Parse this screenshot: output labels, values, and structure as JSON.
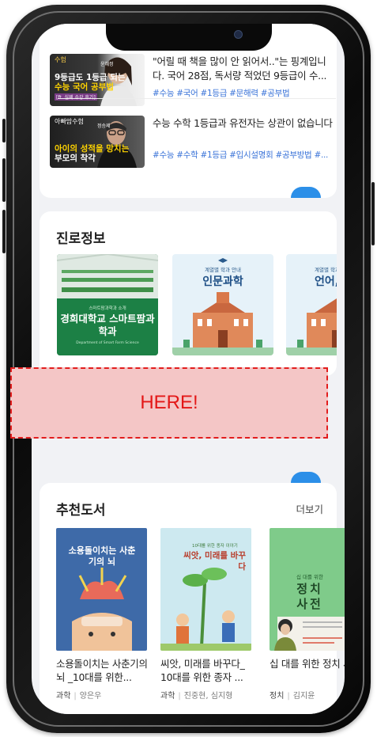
{
  "videos": [
    {
      "thumb_badge": "수험",
      "thumb_name": "윤혜정",
      "thumb_line1": "9등급도 1등급 되는",
      "thumb_line2": "수능 국어 공부법",
      "thumb_line3": "[ft. 실제 수강 후기]",
      "title": "\"어릴 때 책을 많이 안 읽어서..\"는 핑계입니다. 국어 28점, 독서량 적었던 9등급이 수...",
      "tags": "#수능 #국어 #1등급 #문해력 #공부법"
    },
    {
      "thumb_badge": "아빠맘수험",
      "thumb_name": "정승제",
      "thumb_line1": "아이의 성적을 망치는",
      "thumb_line2": "부모의 착각",
      "title": "수능 수학 1등급과 유전자는 상관이 없습니다",
      "tags": "#수능 #수학 #1등급 #입시설명회 #공부방법 #..."
    }
  ],
  "career": {
    "title": "진로정보",
    "items": [
      {
        "caption_small": "스마트팜과학과 소개",
        "caption_main": "경희대학교 스마트팜과학과",
        "caption_sub": "Department of Smart Farm Science"
      },
      {
        "caption_small": "계열별 학과 안내",
        "caption_main": "인문과학"
      },
      {
        "caption_small": "계열별 학과",
        "caption_main": "언어, 문"
      }
    ]
  },
  "placeholder": {
    "label": "HERE!"
  },
  "books": {
    "title": "추천도서",
    "more_label": "더보기",
    "items": [
      {
        "cover_title": "소용돌이치는 사춘기의 뇌",
        "title": "소용돌이치는 사춘기의 뇌 _10대를 위한...",
        "category": "과학",
        "author": "양은우"
      },
      {
        "cover_title": "씨앗, 미래를 바꾸다",
        "cover_small": "10대를 위한 종자 이야기",
        "title": "씨앗, 미래를 바꾸다_ 10대를 위한 종자 ...",
        "category": "과학",
        "author": "진중현, 심지형"
      },
      {
        "cover_small": "십 대를 위한",
        "cover_title": "정치 사전",
        "title": "십 대를 위한 정치 사전",
        "category": "정치",
        "author": "김지윤"
      }
    ]
  },
  "colors": {
    "accent_blue": "#2c8fe8",
    "tag_blue": "#3b74d8",
    "here_red": "#e31717",
    "here_fill": "#f4c6c6"
  }
}
